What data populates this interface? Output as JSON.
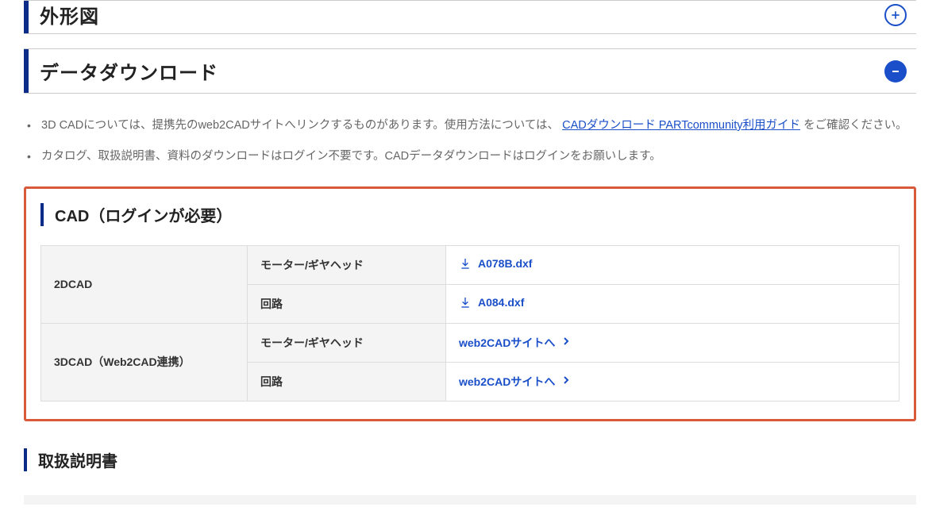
{
  "accordion": {
    "outline_title": "外形図",
    "download_title": "データダウンロード"
  },
  "notes": {
    "item1_prefix": "3D CADについては、提携先のweb2CADサイトへリンクするものがあります。使用方法については、",
    "item1_link": "CADダウンロード PARTcommunity利用ガイド",
    "item1_suffix": " をご確認ください。",
    "item2": "カタログ、取扱説明書、資料のダウンロードはログイン不要です。CADデータダウンロードはログインをお願いします。"
  },
  "cad": {
    "heading": "CAD（ログインが必要）",
    "rows": {
      "r2d_label": "2DCAD",
      "r3d_label": "3DCAD（Web2CAD連携）",
      "sub_motor": "モーター/ギヤヘッド",
      "sub_circuit": "回路"
    },
    "files": {
      "f1": "A078B.dxf",
      "f2": "A084.dxf",
      "ext": "web2CADサイトへ"
    }
  },
  "manual_heading": "取扱説明書"
}
